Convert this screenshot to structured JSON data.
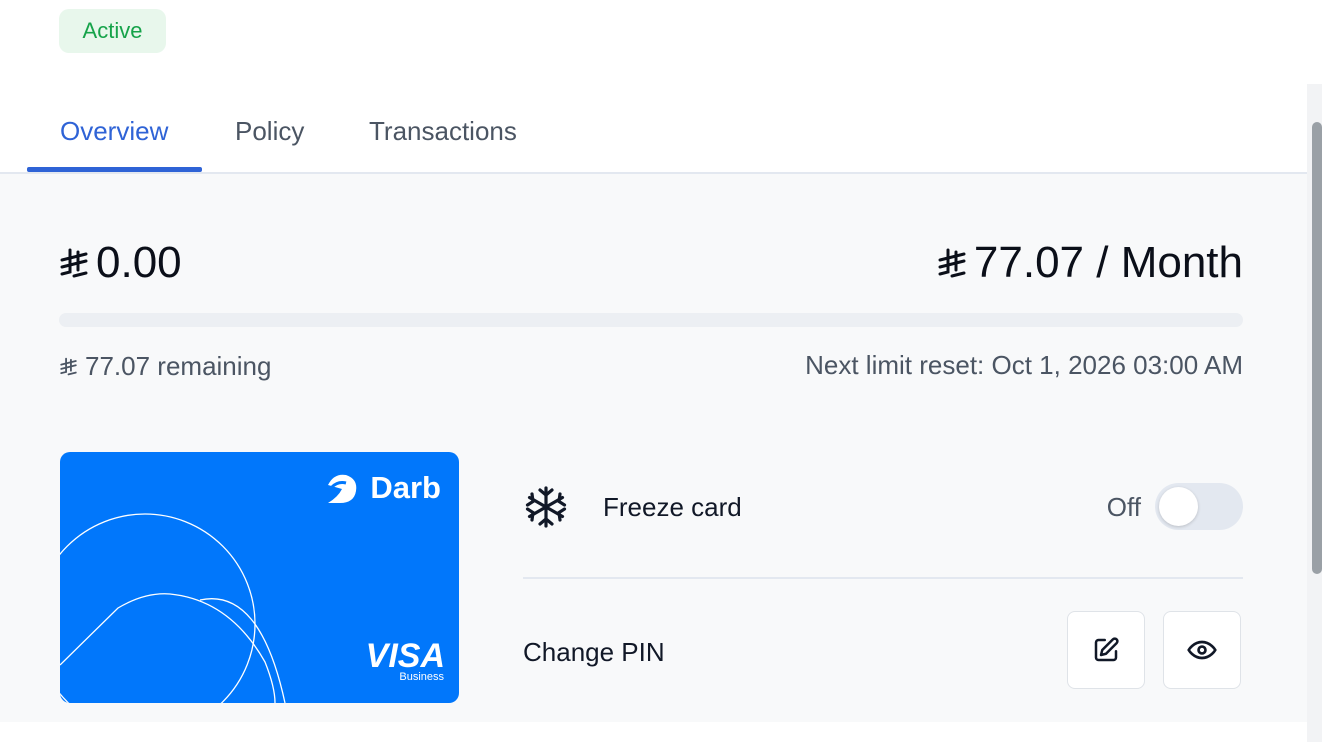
{
  "status_badge": "Active",
  "tabs": [
    {
      "label": "Overview",
      "active": true
    },
    {
      "label": "Policy",
      "active": false
    },
    {
      "label": "Transactions",
      "active": false
    }
  ],
  "spend": {
    "currency_symbol_icon": "saudi-riyal-icon",
    "spent": "0.00",
    "limit": "77.07 / Month",
    "progress_fraction": 0,
    "remaining": "77.07 remaining",
    "next_reset": "Next limit reset: Oct 1, 2026 03:00 AM"
  },
  "card": {
    "brand": "Darb",
    "network": "VISA",
    "network_sub": "Business",
    "color": "#0177fb"
  },
  "controls": {
    "freeze_label": "Freeze card",
    "freeze_state": "Off",
    "freeze_on": false,
    "change_pin_label": "Change PIN"
  },
  "colors": {
    "accent": "#2f63d6",
    "active_badge_text": "#16a34a",
    "active_badge_bg": "#e8f7ec"
  }
}
